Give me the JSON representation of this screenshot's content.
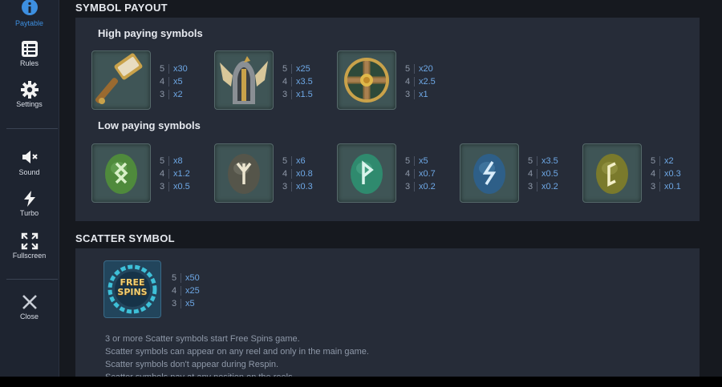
{
  "sidebar": {
    "items": [
      {
        "label": "Paytable",
        "icon": "info-icon",
        "active": true
      },
      {
        "label": "Rules",
        "icon": "list-icon"
      },
      {
        "label": "Settings",
        "icon": "gear-icon"
      },
      {
        "label": "Sound",
        "icon": "speaker-muted-icon"
      },
      {
        "label": "Turbo",
        "icon": "lightning-icon"
      },
      {
        "label": "Fullscreen",
        "icon": "fullscreen-icon"
      },
      {
        "label": "Close",
        "icon": "close-icon"
      }
    ]
  },
  "symbol_payout": {
    "title": "SYMBOL PAYOUT",
    "high": {
      "title": "High paying symbols",
      "symbols": [
        {
          "icon": "hammer-icon",
          "pays": [
            {
              "count": "5",
              "mult": "x30"
            },
            {
              "count": "4",
              "mult": "x5"
            },
            {
              "count": "3",
              "mult": "x2"
            }
          ]
        },
        {
          "icon": "winged-helmet-icon",
          "pays": [
            {
              "count": "5",
              "mult": "x25"
            },
            {
              "count": "4",
              "mult": "x3.5"
            },
            {
              "count": "3",
              "mult": "x1.5"
            }
          ]
        },
        {
          "icon": "shield-icon",
          "pays": [
            {
              "count": "5",
              "mult": "x20"
            },
            {
              "count": "4",
              "mult": "x2.5"
            },
            {
              "count": "3",
              "mult": "x1"
            }
          ]
        }
      ]
    },
    "low": {
      "title": "Low paying symbols",
      "symbols": [
        {
          "icon": "green-rune-stone-icon",
          "color": "#4f8a3c",
          "pays": [
            {
              "count": "5",
              "mult": "x8"
            },
            {
              "count": "4",
              "mult": "x1.2"
            },
            {
              "count": "3",
              "mult": "x0.5"
            }
          ]
        },
        {
          "icon": "grey-rune-stone-icon",
          "color": "#55554a",
          "pays": [
            {
              "count": "5",
              "mult": "x6"
            },
            {
              "count": "4",
              "mult": "x0.8"
            },
            {
              "count": "3",
              "mult": "x0.3"
            }
          ]
        },
        {
          "icon": "teal-rune-stone-icon",
          "color": "#2f8a6e",
          "pays": [
            {
              "count": "5",
              "mult": "x5"
            },
            {
              "count": "4",
              "mult": "x0.7"
            },
            {
              "count": "3",
              "mult": "x0.2"
            }
          ]
        },
        {
          "icon": "blue-rune-stone-icon",
          "color": "#2e5f88",
          "pays": [
            {
              "count": "5",
              "mult": "x3.5"
            },
            {
              "count": "4",
              "mult": "x0.5"
            },
            {
              "count": "3",
              "mult": "x0.2"
            }
          ]
        },
        {
          "icon": "olive-rune-stone-icon",
          "color": "#7a7a2c",
          "pays": [
            {
              "count": "5",
              "mult": "x2"
            },
            {
              "count": "4",
              "mult": "x0.3"
            },
            {
              "count": "3",
              "mult": "x0.1"
            }
          ]
        }
      ]
    }
  },
  "scatter": {
    "title": "SCATTER SYMBOL",
    "badge": {
      "line1": "FREE",
      "line2": "SPINS"
    },
    "pays": [
      {
        "count": "5",
        "mult": "x50"
      },
      {
        "count": "4",
        "mult": "x25"
      },
      {
        "count": "3",
        "mult": "x5"
      }
    ],
    "description": [
      "3 or more Scatter symbols start Free Spins game.",
      "Scatter symbols can appear on any reel and only in the main game.",
      "Scatter symbols don't appear during Respin.",
      "Scatter symbols pay at any position on the reels."
    ]
  },
  "colors": {
    "accent": "#3d8fe0",
    "multiplier": "#6ea8e6",
    "panel": "#262c38"
  }
}
